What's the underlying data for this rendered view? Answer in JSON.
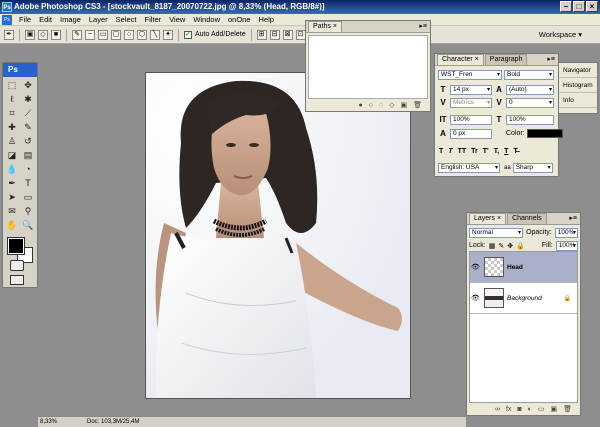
{
  "window": {
    "title": "Adobe Photoshop CS3 - [stockvault_8187_20070722.jpg @ 8,33% (Head, RGB/8#)]",
    "app_icon": "Ps"
  },
  "menu": [
    "File",
    "Edit",
    "Image",
    "Layer",
    "Select",
    "Filter",
    "View",
    "Window",
    "onOne",
    "Help"
  ],
  "options_bar": {
    "auto_add_delete_label": "Auto Add/Delete",
    "workspace_label": "Workspace ▾"
  },
  "toolbox": {
    "title": "Ps"
  },
  "paths_panel": {
    "tab": "Paths"
  },
  "character_panel": {
    "tabs": [
      "Character",
      "Paragraph"
    ],
    "font_family": "WST_Fren",
    "font_style": "Bold",
    "size": "14 px",
    "leading": "(Auto)",
    "kerning": "Metrics",
    "tracking": "0",
    "vscale": "100%",
    "hscale": "100%",
    "baseline": "0 px",
    "color_label": "Color:",
    "language": "English: USA",
    "aa_label": "a",
    "antialias": "Sharp",
    "format_buttons": [
      "T",
      "T",
      "TT",
      "Tr",
      "T'",
      "T,",
      "T",
      "T̶"
    ]
  },
  "side_dock": [
    "Navigator",
    "Histogram",
    "Info"
  ],
  "layers_panel": {
    "tabs": [
      "Layers",
      "Channels"
    ],
    "blend_mode": "Normal",
    "opacity_label": "Opacity:",
    "opacity": "100%",
    "lock_label": "Lock:",
    "fill_label": "Fill:",
    "fill": "100%",
    "layers": [
      {
        "name": "Head",
        "active": true
      },
      {
        "name": "Background",
        "active": false
      }
    ]
  },
  "status_bar": {
    "zoom": "8,33%",
    "doc": "Doc: 103,3M/25,4M"
  },
  "colors": {
    "title_bar": "#0a246a",
    "canvas_bg": "#8e8e8e",
    "active_layer": "#a9b0c9"
  }
}
